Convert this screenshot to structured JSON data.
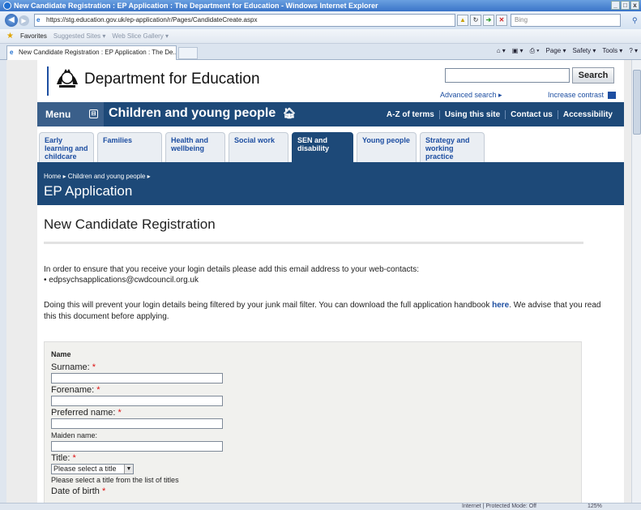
{
  "browser": {
    "window_title": "New Candidate Registration : EP Application : The Department for Education - Windows Internet Explorer",
    "url": "https://stg.education.gov.uk/ep-application/r/Pages/CandidateCreate.aspx",
    "search_placeholder": "Bing",
    "favorites_label": "Favorites",
    "suggested_sites": "Suggested Sites ▾",
    "web_slice": "Web Slice Gallery ▾",
    "tab_title": "New Candidate Registration : EP Application : The De...",
    "cmd_page": "Page ▾",
    "cmd_safety": "Safety ▾",
    "cmd_tools": "Tools ▾",
    "status_zone": "Internet | Protected Mode: Off",
    "zoom": "125%"
  },
  "header": {
    "logo_text": "Department for Education",
    "search_button": "Search",
    "advanced_search": "Advanced search ▸",
    "increase_contrast": "Increase contrast"
  },
  "navbar": {
    "menu_label": "Menu",
    "menu_toggle": "⊟",
    "section_title": "Children and young people",
    "links": [
      "A-Z of terms",
      "Using this site",
      "Contact us",
      "Accessibility"
    ]
  },
  "category_tabs": [
    "Early learning and childcare",
    "Families",
    "Health and wellbeing",
    "Social work",
    "SEN and disability",
    "Young people",
    "Strategy and working practice"
  ],
  "banner": {
    "breadcrumb": "Home ▸  Children and young people ▸",
    "title": "EP Application"
  },
  "main": {
    "page_title": "New Candidate Registration",
    "intro_line": "In order to ensure that you receive your login details please add this email address to your web-contacts:",
    "email_bullet": "•  edpsychsapplications@cwdcouncil.org.uk",
    "p2_before": "Doing this will prevent your login details being filtered by your junk mail filter. You can download the full application handbook ",
    "p2_link": "here",
    "p2_after": ". We advise that you read this this document before applying."
  },
  "form": {
    "legend": "Name",
    "required_marker": "*",
    "surname_label": "Surname:",
    "forename_label": "Forename:",
    "preferred_label": "Preferred name:",
    "maiden_label": "Maiden name:",
    "title_label": "Title:",
    "title_select": "Please select a title",
    "title_hint": "Please select a title from the list of titles",
    "dob_label": "Date of birth"
  },
  "colors": {
    "nav_blue": "#1d4978",
    "link_blue": "#1d4ea1",
    "required_red": "#dd1111"
  }
}
